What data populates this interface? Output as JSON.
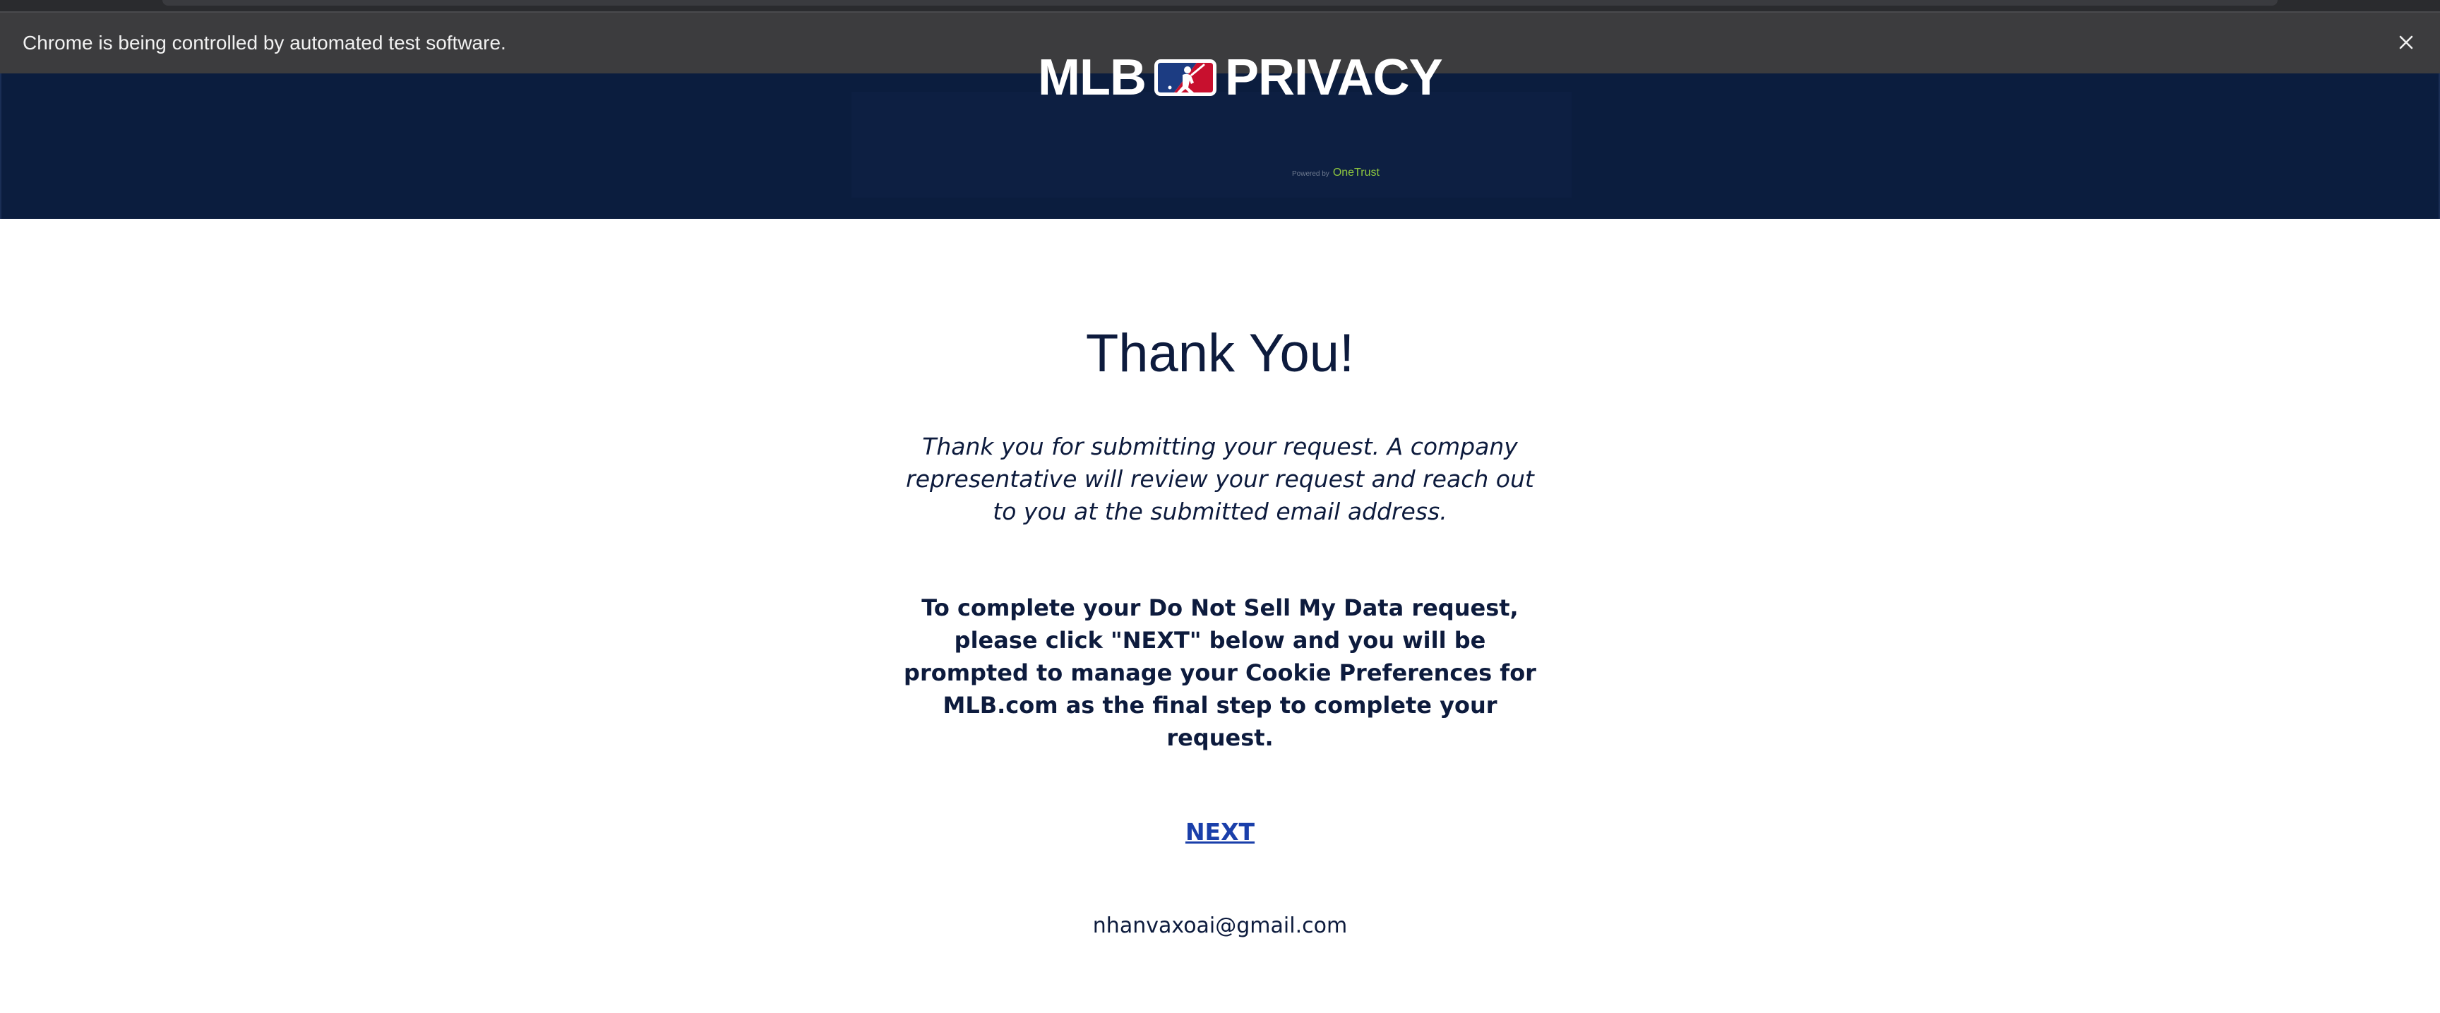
{
  "browser": {
    "automation_notice": "Chrome is being controlled by automated test software."
  },
  "header": {
    "logo_left": "MLB",
    "logo_right": "PRIVACY",
    "powered_by": "Powered by",
    "powered_brand": "OneTrust",
    "colors": {
      "background": "#0b1d3e",
      "mark_blue": "#1c3c82",
      "mark_red": "#c8102e"
    }
  },
  "main": {
    "title": "Thank You!",
    "message": "Thank you for submitting your request. A company representative will review your request and reach out to you at the submitted email address.",
    "instruction": "To complete your Do Not Sell My Data request, please click \"NEXT\" below and you will be prompted to manage your Cookie Preferences for MLB.com as the final step to complete your request.",
    "next_label": "NEXT",
    "email": "nhanvaxoai@gmail.com",
    "colors": {
      "text": "#0d1b3d",
      "link": "#1a3faa"
    }
  },
  "icons": {
    "close": "close-icon",
    "logo_mark": "mlb-batter-logo-icon"
  }
}
